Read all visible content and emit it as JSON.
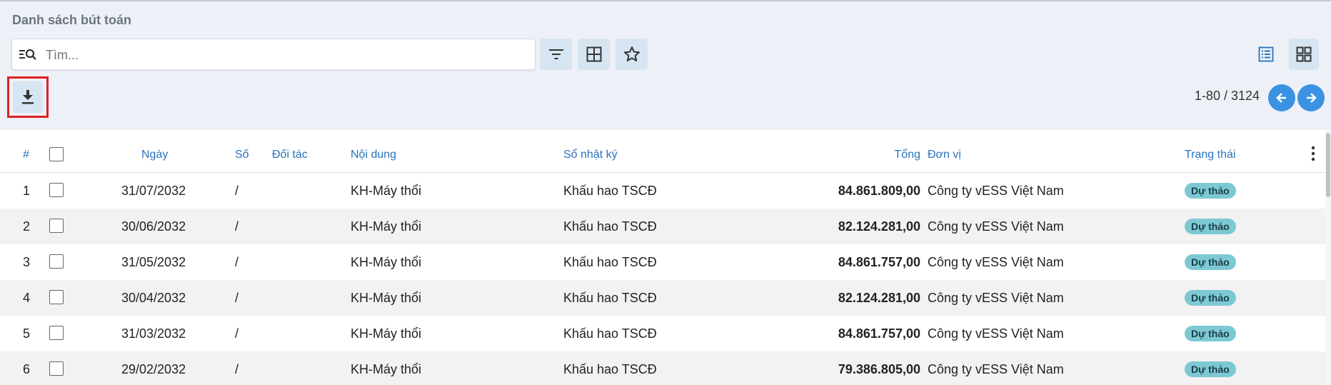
{
  "header": {
    "title": "Danh sách bút toán",
    "search_placeholder": "Tìm...",
    "search_value": ""
  },
  "toolbar": {
    "filter_icon": "filter-icon",
    "group_icon": "grid-icon",
    "favorite_icon": "star-icon",
    "list_view_icon": "list-view-icon",
    "kanban_view_icon": "kanban-view-icon",
    "download_icon": "download-icon"
  },
  "pager": {
    "text": "1-80 / 3124"
  },
  "table": {
    "columns": [
      "#",
      "Ngày",
      "Số",
      "Đối tác",
      "Nội dung",
      "Sổ nhật ký",
      "Tổng",
      "Đơn vị",
      "Trạng thái"
    ],
    "rows": [
      {
        "idx": "1",
        "date": "31/07/2032",
        "number": "/",
        "partner": "",
        "content": "KH-Máy thổi",
        "journal": "Khấu hao TSCĐ",
        "total": "84.861.809,00",
        "company": "Công ty vESS Việt Nam",
        "status": "Dự thảo"
      },
      {
        "idx": "2",
        "date": "30/06/2032",
        "number": "/",
        "partner": "",
        "content": "KH-Máy thổi",
        "journal": "Khấu hao TSCĐ",
        "total": "82.124.281,00",
        "company": "Công ty vESS Việt Nam",
        "status": "Dự thảo"
      },
      {
        "idx": "3",
        "date": "31/05/2032",
        "number": "/",
        "partner": "",
        "content": "KH-Máy thổi",
        "journal": "Khấu hao TSCĐ",
        "total": "84.861.757,00",
        "company": "Công ty vESS Việt Nam",
        "status": "Dự thảo"
      },
      {
        "idx": "4",
        "date": "30/04/2032",
        "number": "/",
        "partner": "",
        "content": "KH-Máy thổi",
        "journal": "Khấu hao TSCĐ",
        "total": "82.124.281,00",
        "company": "Công ty vESS Việt Nam",
        "status": "Dự thảo"
      },
      {
        "idx": "5",
        "date": "31/03/2032",
        "number": "/",
        "partner": "",
        "content": "KH-Máy thổi",
        "journal": "Khấu hao TSCĐ",
        "total": "84.861.757,00",
        "company": "Công ty vESS Việt Nam",
        "status": "Dự thảo"
      },
      {
        "idx": "6",
        "date": "29/02/2032",
        "number": "/",
        "partner": "",
        "content": "KH-Máy thổi",
        "journal": "Khấu hao TSCĐ",
        "total": "79.386.805,00",
        "company": "Công ty vESS Việt Nam",
        "status": "Dự thảo"
      }
    ]
  },
  "colors": {
    "accent": "#2a73ba",
    "button_bg": "#d7e5f2",
    "nav_button": "#3b92e3",
    "badge": "#7cc9d4",
    "highlight": "#e02020"
  }
}
